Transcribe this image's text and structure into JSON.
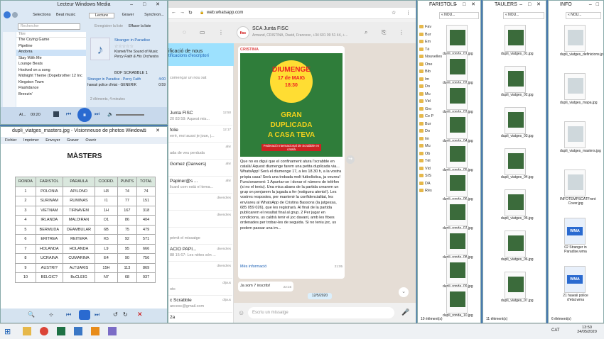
{
  "desktop": {
    "bg": "#4a7ab0"
  },
  "wmp": {
    "title": "Lecteur Windows Media",
    "nav": [
      "Selections",
      "Beat music"
    ],
    "search_placeholder": "Rechercher",
    "tabs": [
      "Lecture",
      "Graver",
      "Synchron..."
    ],
    "save_list": "Enregistrer la liste",
    "clear_list": "Effacer la liste",
    "col_title": "Titre",
    "tracks": [
      "The Crying Game",
      "Pipeline",
      "Andorra",
      "Stay With Me",
      "Lounge Beats",
      "Hooked on a song",
      "Midnight Theme (Dopebrother 12 Inc",
      "Kingston Town",
      "Flashdance",
      "Breezin'"
    ],
    "album_title": "Stranger in Paradise",
    "album_artist": "Kismet/The Sound of Music",
    "album_orch": "Percy Faith & His Orchestra",
    "playlist_name": "BOF SCRABBLE 1",
    "pl": [
      {
        "t": "Stranger in Paradise - Percy Faith",
        "d": "4:00"
      },
      {
        "t": "hawaii police d'etat - GENERIK",
        "d": "0:59"
      }
    ],
    "items_count": "2 éléments, 4 minutes",
    "artist_short": "Al...",
    "time": "00:20"
  },
  "photo": {
    "title": "dupli_viatges_masters.jpg - Visionneuse de photos Windows",
    "menu": [
      "Fichier",
      "Imprimer",
      "Envoyer",
      "Graver",
      "Ouvrir"
    ],
    "heading": "MÀSTERS",
    "headers": [
      "RONDA",
      "FARISTOL",
      "PARAULA",
      "COORD.",
      "PUNTS",
      "TOTAL"
    ],
    "rows": [
      [
        "1",
        "POLONIA",
        "APILONO",
        "H3",
        "74",
        "74"
      ],
      [
        "2",
        "SURINAM",
        "RUMINAS",
        "I1",
        "77",
        "151"
      ],
      [
        "3",
        "VIETNAM",
        "TIRNAVEM",
        "1H",
        "167",
        "318"
      ],
      [
        "4",
        "IRLANDA",
        "MALDIRAN",
        "O1",
        "86",
        "404"
      ],
      [
        "5",
        "BERMUDA",
        "DEAMBULAR",
        "6B",
        "75",
        "479"
      ],
      [
        "6",
        "ERITREA",
        "REITERA",
        "K5",
        "92",
        "571"
      ],
      [
        "7",
        "HOLANDA",
        "HOLANDA",
        "L9",
        "95",
        "666"
      ],
      [
        "8",
        "UCRAINA",
        "CUMARINA",
        "E4",
        "90",
        "756"
      ],
      [
        "9",
        "AUSTRI?",
        "AcTUARIS",
        "15H",
        "113",
        "869"
      ],
      [
        "10",
        "BELGIC?",
        "BuCLEIG",
        "N7",
        "68",
        "937"
      ]
    ]
  },
  "browser": {
    "url": "web.whatsapp.com",
    "chat_name": "SCA Junta FISC",
    "chat_members": "Armand, CRISTINA, David, Francesc, +34 601 09 51 44, +...",
    "notif1": "ificació de nous",
    "notif2": "tificacions d'escriptori",
    "start_chat": "començar un nou xat",
    "chats": [
      {
        "n": "Junta FISC",
        "m": "20 83 59: Aquest mis...",
        "t": "12:50"
      },
      {
        "n": "folie",
        "m": "erré, moi aussi je joue, j...",
        "t": "12:17"
      },
      {
        "n": "",
        "m": "ada de veu perduda",
        "t": "ahir"
      },
      {
        "n": "Gomez (Danvers)",
        "m": "",
        "t": "ahir"
      },
      {
        "n": "Papiner@s ...",
        "m": "licard com està el tema...",
        "t": "ahir"
      },
      {
        "n": "",
        "m": "",
        "t": "divendres"
      },
      {
        "n": "",
        "m": "",
        "t": "divendres"
      },
      {
        "n": "",
        "m": "primit el missatge",
        "t": ""
      },
      {
        "n": "ACIÓ PAPI...",
        "m": "88 15 67: Les nètes són ...",
        "t": "divendres"
      },
      {
        "n": "",
        "m": "",
        "t": "divendres"
      },
      {
        "n": "",
        "m": "oto",
        "t": "dijous"
      },
      {
        "n": "c Scrabble",
        "m": "ancesc@gmail.com",
        "t": "dijous"
      },
      {
        "n": "2a",
        "m": "",
        "t": ""
      }
    ],
    "sender": "CRISTINA",
    "poster_l1": "DIUMENGE",
    "poster_l2": "17 de MAIG",
    "poster_l3": "18:30",
    "poster_l4": "GRAN",
    "poster_l5": "DUPLICADA",
    "poster_l6": "A CASA TEVA",
    "poster_foot": "Federació Internacional de Scrabble en català",
    "msg": "Que no es digui que el confinament atura l'scrabble en català! Aquest diumenge farem una petita duplicada via... WhatsApp! Serà el diumenge 17, a les 18.30 h, a la vostra pròpia casa! Serà una trobada molt futbolística, ja veureu! Funcionament: 1 Apuntar-se i donar el número de telèfon (si no el teniu). Una mica abans de la partida crearem un grup on penjarem la jugada a fer (estigueu atents!). Les vostres respostes, per mantenir la confidencialitat, les envíareu al WhatsApp de Cristina Bassons (la jutgessa, 685 059 026), que les registrarà. Al final de la partida publicarem el resultat final al grup. 2 Per jugar en condicions, us caldrà tenir el joc davant, amb les fitxes ordenades per trobar-les de seguida. Si no teniu joc, us podem passar una im...",
    "msg_time": "21:05",
    "more": "Més informació",
    "reply": "Ja som 7 inscrits!",
    "reply_time": "22:15",
    "date_chip": "12/5/2020",
    "input_placeholder": "Escriu un missatge"
  },
  "faristols": {
    "title": "FARISTOLS",
    "path": "« NOU...",
    "tree": [
      "Fav",
      "Bur",
      "Em",
      "Té",
      "Nouvelles",
      "One",
      "Bib",
      "Im",
      "Do",
      "Mu",
      "Vid",
      "Gro",
      "Ce P",
      "Bur",
      "Do",
      "Im",
      "Mu",
      "Ob",
      "Tél",
      "Vid",
      "SIS",
      "DA",
      "Rés"
    ],
    "files": [
      "dupli_ronda_01.jpg",
      "dupli_ronda_02.jpg",
      "dupli_ronda_03.jpg",
      "dupli_ronda_04.jpg",
      "dupli_ronda_05.jpg",
      "dupli_ronda_06.jpg",
      "dupli_ronda_07.jpg",
      "dupli_ronda_08.jpg",
      "dupli_ronda_09.jpg",
      "dupli_ronda_10.jpg"
    ],
    "status": "10 élément(s)"
  },
  "taulers": {
    "title": "TAULERS",
    "path": "« NOU...",
    "files": [
      "dupli_viatges_01.jpg",
      "dupli_viatges_02.jpg",
      "dupli_viatges_03.jpg",
      "dupli_viatges_04.jpg",
      "dupli_viatges_05.jpg",
      "dupli_viatges_06.jpg",
      "dupli_viatges_07.jpg"
    ],
    "status": "11 élément(s)"
  },
  "info": {
    "title": "INFO",
    "path": "« NOU...",
    "files": [
      "dupli_viatges_definicions.jpg",
      "dupli_viatges_mapa.jpg",
      "dupli_viatges_masters.jpg",
      "INFOTEMPSCATFront Cover.jpg",
      "02 Stranger in Paradise.wma",
      "21 hawaii police d'etat.wma"
    ],
    "wma": "WMA",
    "status": "6 élément(s)"
  },
  "taskbar": {
    "lang": "CAT",
    "time": "13:50",
    "date": "24/05/2020"
  }
}
